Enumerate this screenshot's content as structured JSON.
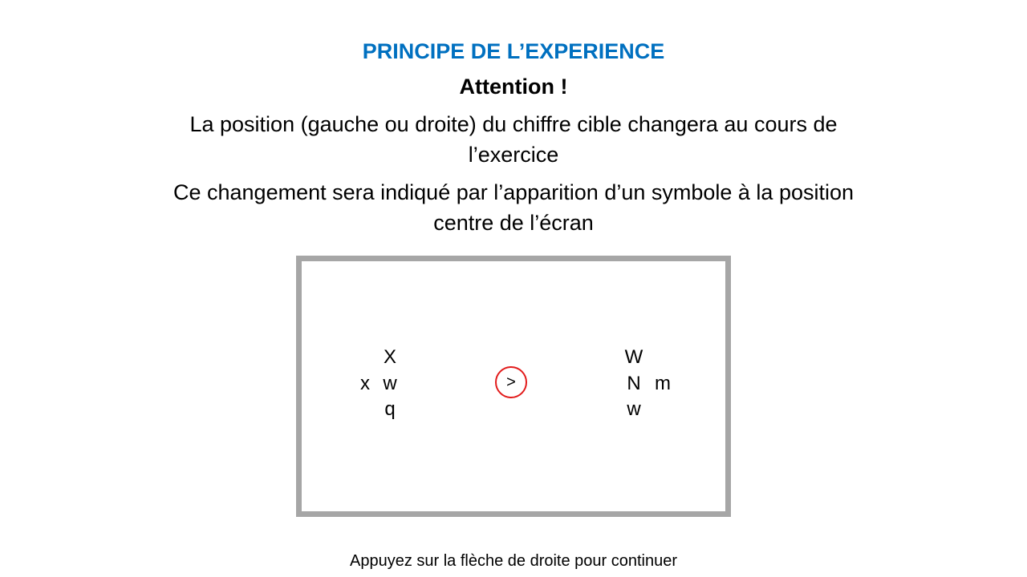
{
  "slide": {
    "title": "PRINCIPE DE L’EXPERIENCE",
    "title_color": "#0070c0",
    "attention": "Attention !",
    "paragraph_1": "La position (gauche ou droite) du chiffre cible changera au cours de l’exercice",
    "paragraph_2": "Ce changement sera indiqué par l’apparition d’un symbole à la position centre de l’écran",
    "footer_instruction": "Appuyez sur la flèche de droite pour continuer"
  },
  "stimulus": {
    "frame_color": "#a6a6a6",
    "highlight_color": "#e21b1b",
    "left_cluster": {
      "top": "X",
      "left": "x",
      "center": "w",
      "bottom": "q"
    },
    "center_symbol": ">",
    "right_cluster": {
      "top": "W",
      "center": "N",
      "right": "m",
      "bottom": "w"
    }
  }
}
